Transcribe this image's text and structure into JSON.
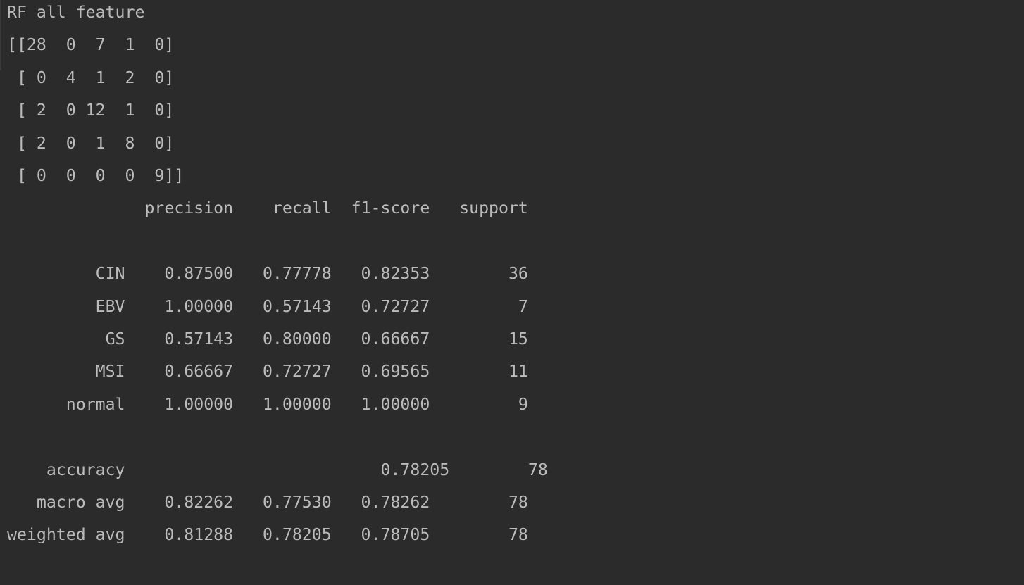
{
  "console": {
    "title_line": "RF all feature",
    "confusion_matrix": [
      "[[28  0  7  1  0]",
      " [ 0  4  1  2  0]",
      " [ 2  0 12  1  0]",
      " [ 2  0  1  8  0]",
      " [ 0  0  0  0  9]]"
    ],
    "report_header": "              precision    recall  f1-score   support",
    "report_rows": [
      "         CIN    0.87500   0.77778   0.82353        36",
      "         EBV    1.00000   0.57143   0.72727         7",
      "          GS    0.57143   0.80000   0.66667        15",
      "         MSI    0.66667   0.72727   0.69565        11",
      "      normal    1.00000   1.00000   1.00000         9"
    ],
    "summary_rows": [
      "    accuracy                          0.78205        78",
      "   macro avg    0.82262   0.77530   0.78262        78",
      "weighted avg    0.81288   0.78205   0.78705        78"
    ]
  }
}
